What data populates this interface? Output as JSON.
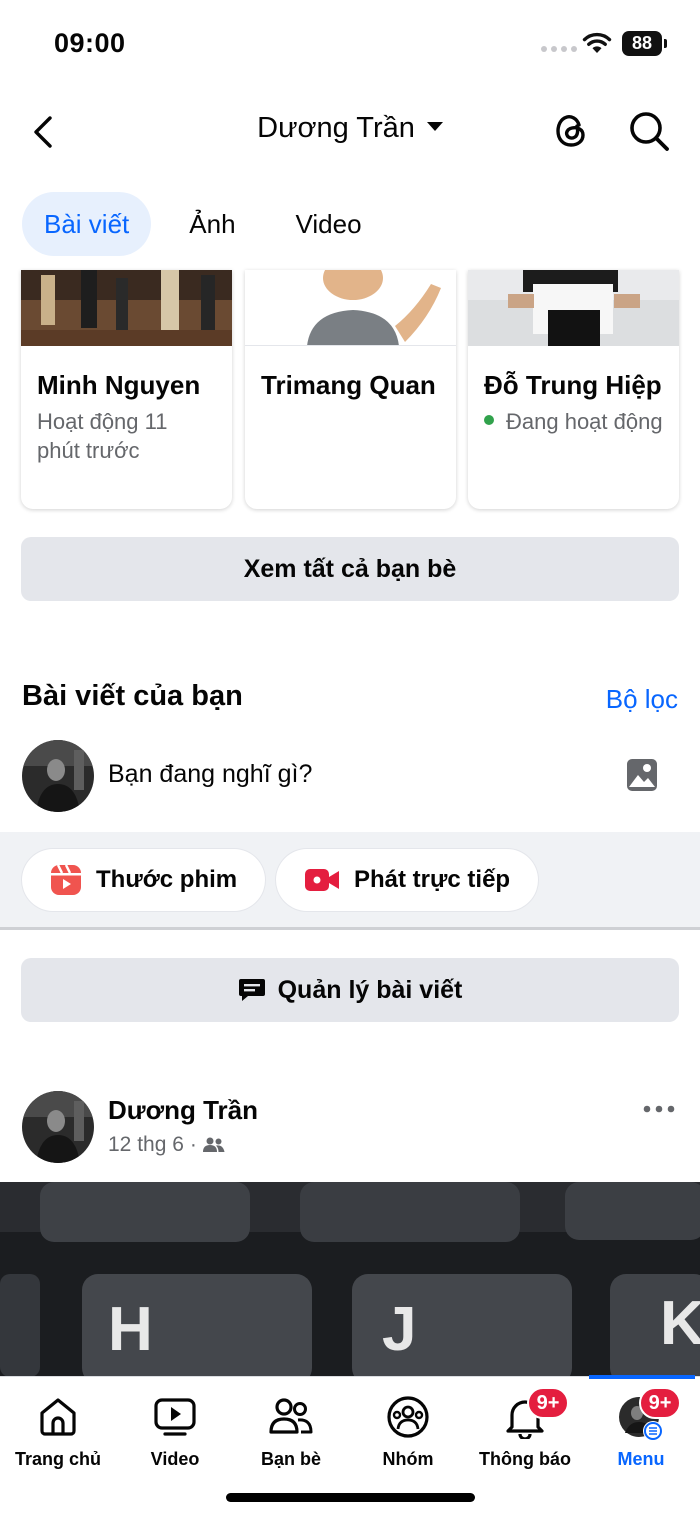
{
  "status_bar": {
    "time": "09:00",
    "battery": "88"
  },
  "header": {
    "title": "Dương Trần"
  },
  "tabs": [
    {
      "label": "Bài viết",
      "active": true
    },
    {
      "label": "Ảnh",
      "active": false
    },
    {
      "label": "Video",
      "active": false
    }
  ],
  "friends": [
    {
      "name": "Minh Nguyen",
      "status": "Hoạt động 11 phút trước",
      "online": false
    },
    {
      "name": "Trimang Quan",
      "status": "",
      "online": false
    },
    {
      "name": "Đỗ Trung Hiệp",
      "status": "Đang hoạt động",
      "online": true
    }
  ],
  "see_all_label": "Xem tất cả bạn bè",
  "posts_section": {
    "title": "Bài viết của bạn",
    "filter_label": "Bộ lọc",
    "composer_placeholder": "Bạn đang nghĩ gì?",
    "reels_label": "Thước phim",
    "live_label": "Phát trực tiếp",
    "manage_label": "Quản lý bài viết"
  },
  "post": {
    "author": "Dương Trần",
    "date": "12 thg 6",
    "privacy_icon": "friends-icon",
    "image_keys": [
      "H",
      "J",
      "K"
    ]
  },
  "bottom_nav": [
    {
      "label": "Trang chủ",
      "icon": "home-icon"
    },
    {
      "label": "Video",
      "icon": "video-icon"
    },
    {
      "label": "Bạn bè",
      "icon": "friends-icon"
    },
    {
      "label": "Nhóm",
      "icon": "groups-icon"
    },
    {
      "label": "Thông báo",
      "icon": "bell-icon",
      "badge": "9+"
    },
    {
      "label": "Menu",
      "icon": "menu-avatar-icon",
      "badge": "9+",
      "active": true
    }
  ],
  "colors": {
    "accent": "#0866ff",
    "badge": "#e41e3f",
    "online": "#31a24c",
    "reels": "#f0544f",
    "live": "#e41e3f"
  }
}
